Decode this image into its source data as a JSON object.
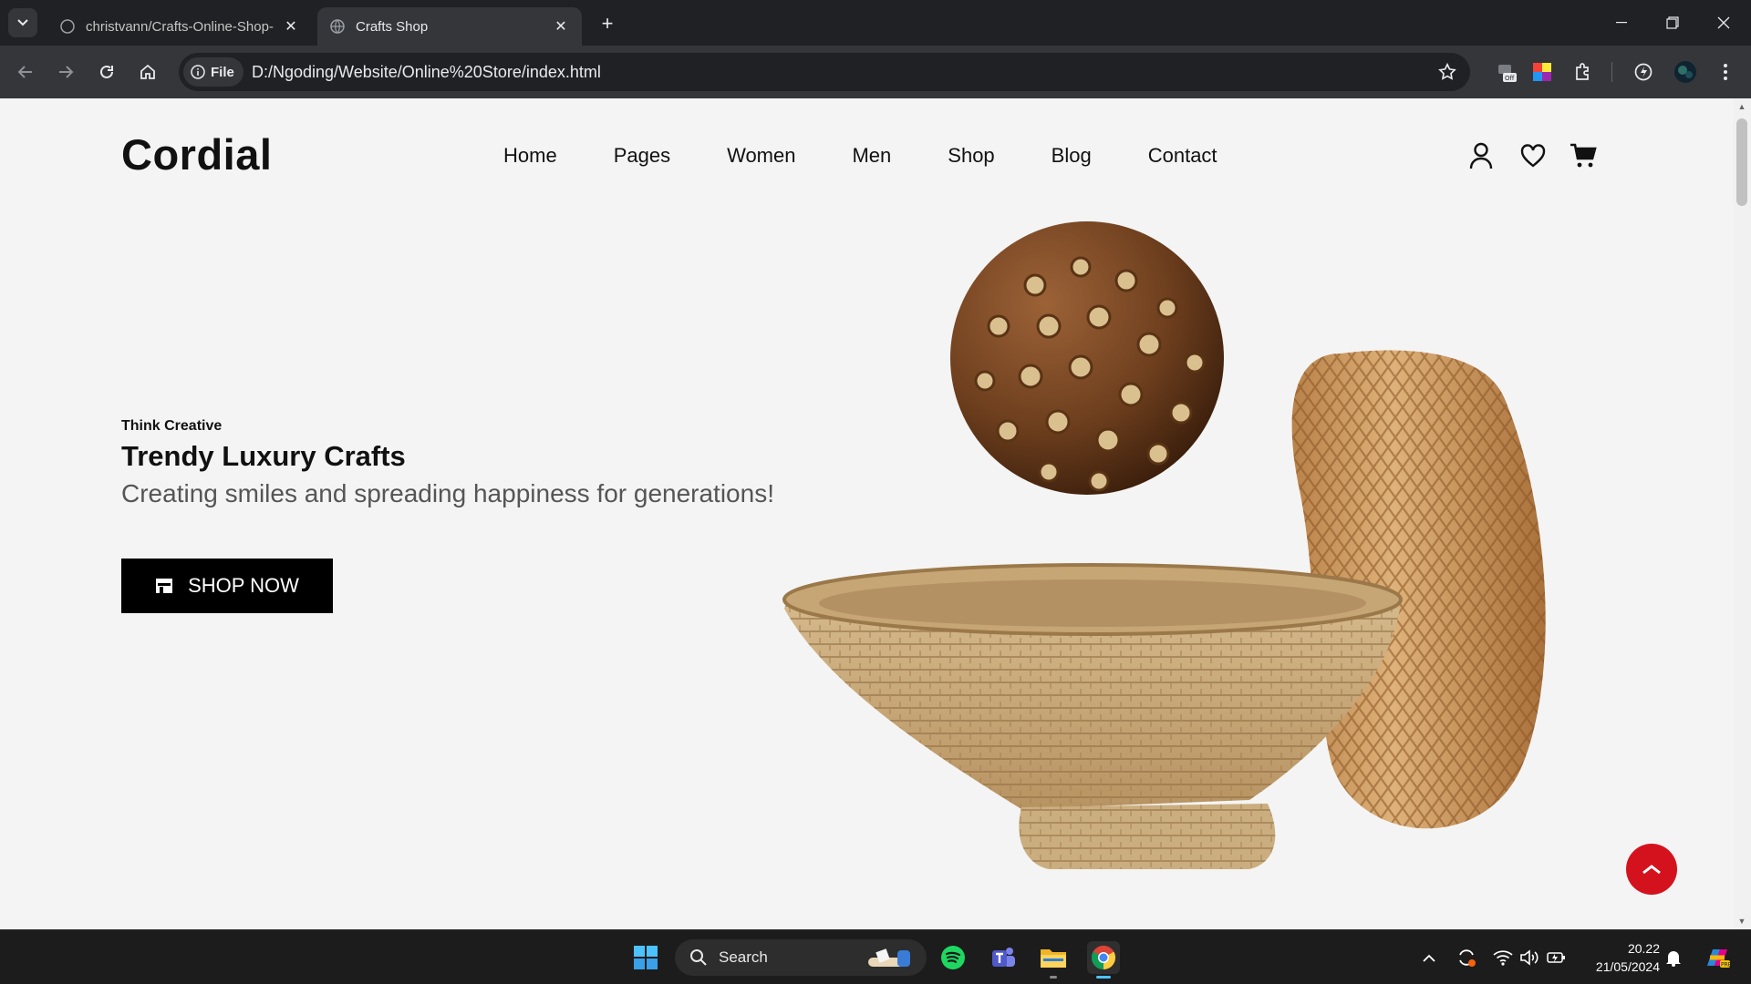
{
  "browser": {
    "tabs": [
      {
        "title": "christvann/Crafts-Online-Shop-",
        "active": false
      },
      {
        "title": "Crafts Shop",
        "active": true
      }
    ],
    "site_chip": "File",
    "url": "D:/Ngoding/Website/Online%20Store/index.html"
  },
  "site": {
    "brand": "Cordial",
    "nav": [
      "Home",
      "Pages",
      "Women",
      "Men",
      "Shop",
      "Blog",
      "Contact"
    ],
    "header_icons": [
      "user-icon",
      "heart-icon",
      "cart-icon"
    ],
    "hero": {
      "eyebrow": "Think Creative",
      "headline": "Trendy Luxury Crafts",
      "subline": "Creating smiles and spreading happiness for generations!",
      "cta": "SHOP NOW"
    },
    "accent_color": "#d3121d"
  },
  "taskbar": {
    "search_label": "Search",
    "time": "20.22",
    "date": "21/05/2024"
  }
}
